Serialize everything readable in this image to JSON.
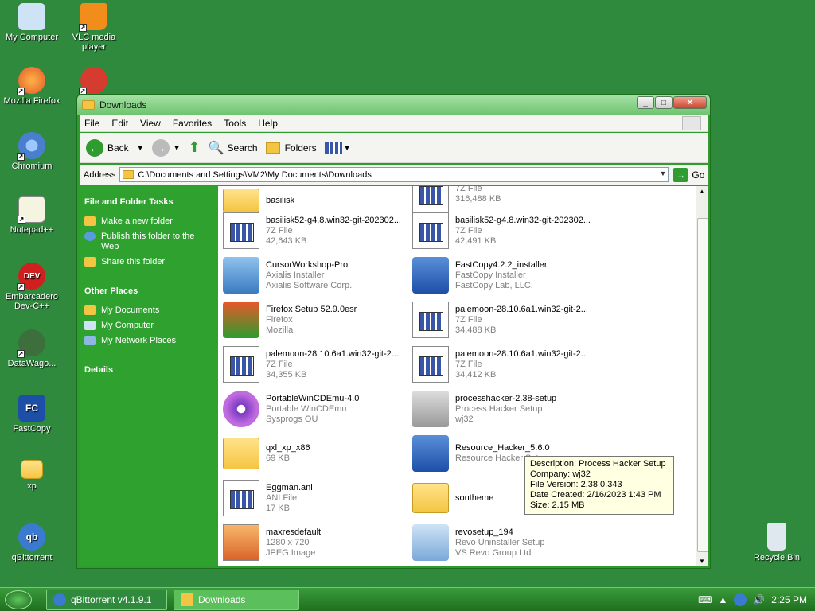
{
  "desktop": {
    "icons": [
      {
        "label": "My Computer",
        "icon": "my-computer-icon"
      },
      {
        "label": "VLC media player",
        "icon": "vlc-icon"
      },
      {
        "label": "Mozilla Firefox",
        "icon": "firefox-icon"
      },
      {
        "label": "Chromium",
        "icon": "chromium-icon"
      },
      {
        "label": "Notepad++",
        "icon": "notepad-plus-plus-icon"
      },
      {
        "label": "Embarcadero Dev-C++",
        "icon": "devcpp-icon"
      },
      {
        "label": "DataWago...",
        "icon": "datawagon-icon"
      },
      {
        "label": "FastCopy",
        "icon": "fastcopy-icon"
      },
      {
        "label": "xp",
        "icon": "folder-icon"
      },
      {
        "label": "qBittorrent",
        "icon": "qbittorrent-icon"
      },
      {
        "label": "Recycle Bin",
        "icon": "recycle-bin-icon"
      }
    ]
  },
  "window": {
    "title": "Downloads",
    "menu": [
      "File",
      "Edit",
      "View",
      "Favorites",
      "Tools",
      "Help"
    ],
    "toolbar": {
      "back": "Back",
      "search": "Search",
      "folders": "Folders"
    },
    "address": {
      "label": "Address",
      "value": "C:\\Documents and Settings\\VM2\\My Documents\\Downloads",
      "go": "Go"
    }
  },
  "taskpane": {
    "file_tasks": {
      "title": "File and Folder Tasks",
      "items": [
        "Make a new folder",
        "Publish this folder to the Web",
        "Share this folder"
      ]
    },
    "other_places": {
      "title": "Other Places",
      "items": [
        "My Documents",
        "My Computer",
        "My Network Places"
      ]
    },
    "details": {
      "title": "Details"
    }
  },
  "files": [
    {
      "name": "basilisk",
      "type": "",
      "size": "",
      "kind": "folder"
    },
    {
      "name": "",
      "type": "7Z File",
      "size": "316,488 KB",
      "kind": "generic"
    },
    {
      "name": "basilisk52-g4.8.win32-git-202302...",
      "type": "7Z File",
      "size": "42,643 KB",
      "kind": "generic"
    },
    {
      "name": "basilisk52-g4.8.win32-git-202302...",
      "type": "7Z File",
      "size": "42,491 KB",
      "kind": "generic"
    },
    {
      "name": "CursorWorkshop-Pro",
      "type": "Axialis Installer",
      "size": "Axialis Software Corp.",
      "kind": "app"
    },
    {
      "name": "FastCopy4.2.2_installer",
      "type": "FastCopy Installer",
      "size": "FastCopy Lab, LLC.",
      "kind": "app"
    },
    {
      "name": "Firefox Setup 52.9.0esr",
      "type": "Firefox",
      "size": "Mozilla",
      "kind": "app"
    },
    {
      "name": "palemoon-28.10.6a1.win32-git-2...",
      "type": "7Z File",
      "size": "34,488 KB",
      "kind": "generic"
    },
    {
      "name": "palemoon-28.10.6a1.win32-git-2...",
      "type": "7Z File",
      "size": "34,355 KB",
      "kind": "generic"
    },
    {
      "name": "palemoon-28.10.6a1.win32-git-2...",
      "type": "7Z File",
      "size": "34,412 KB",
      "kind": "generic"
    },
    {
      "name": "PortableWinCDEmu-4.0",
      "type": "Portable WinCDEmu",
      "size": "Sysprogs OU",
      "kind": "app"
    },
    {
      "name": "processhacker-2.38-setup",
      "type": "Process Hacker Setup",
      "size": "wj32",
      "kind": "app"
    },
    {
      "name": "qxl_xp_x86",
      "type": "69 KB",
      "size": "",
      "kind": "zip"
    },
    {
      "name": "Resource_Hacker_5.6.0",
      "type": "Resource Hacker Setup",
      "size": "",
      "kind": "app"
    },
    {
      "name": "Eggman.ani",
      "type": "ANI File",
      "size": "17 KB",
      "kind": "generic"
    },
    {
      "name": "sontheme",
      "type": "",
      "size": "",
      "kind": "folder"
    },
    {
      "name": "maxresdefault",
      "type": "1280 x 720",
      "size": "JPEG Image",
      "kind": "image"
    },
    {
      "name": "revosetup_194",
      "type": "Revo Uninstaller Setup",
      "size": "VS Revo Group Ltd.",
      "kind": "app"
    }
  ],
  "tooltip": {
    "lines": [
      "Description: Process Hacker Setup",
      "Company: wj32",
      "File Version: 2.38.0.343",
      "Date Created: 2/16/2023 1:43 PM",
      "Size: 2.15 MB"
    ]
  },
  "taskbar": {
    "buttons": [
      "qBittorrent v4.1.9.1",
      "Downloads"
    ],
    "clock": "2:25 PM"
  },
  "colors": {
    "desktop": "#2f8a3e",
    "taskpane": "#2ea12e",
    "accent": "#2e9c2e"
  }
}
